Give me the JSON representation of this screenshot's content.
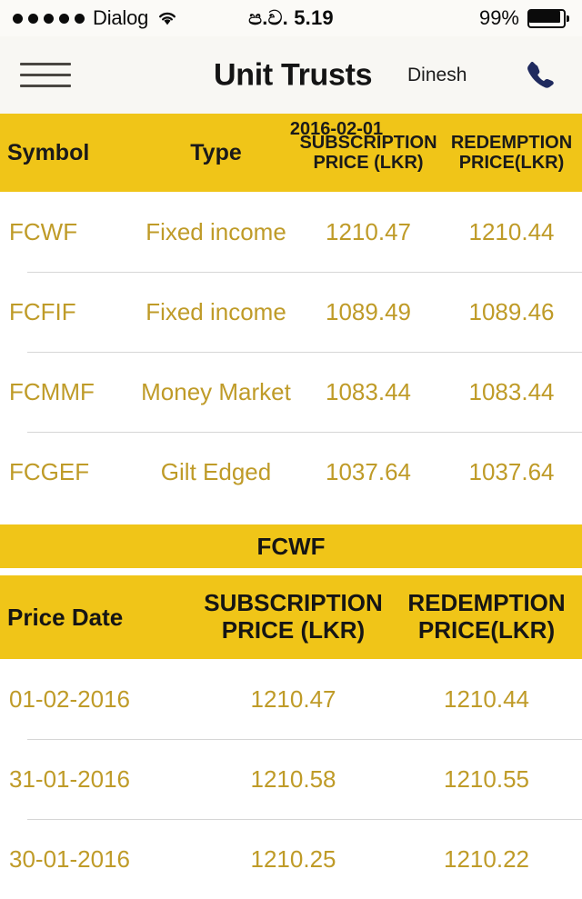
{
  "status_bar": {
    "signal_dots": 5,
    "carrier": "Dialog",
    "wifi_icon": "wifi-icon",
    "time": "ප.ව. 5.19",
    "battery_percent": "99%",
    "battery_level": 99
  },
  "nav_bar": {
    "menu_icon": "hamburger-menu-icon",
    "title": "Unit Trusts",
    "user": "Dinesh",
    "phone_icon": "phone-call-icon"
  },
  "funds_table": {
    "date": "2016-02-01",
    "columns": [
      "Symbol",
      "Type",
      "SUBSCRIPTION PRICE (LKR)",
      "REDEMPTION PRICE(LKR)"
    ],
    "column_labels": {
      "symbol": "Symbol",
      "type": "Type",
      "subscription_line1": "SUBSCRIPTION",
      "subscription_line2": "PRICE (LKR)",
      "redemption_line1": "REDEMPTION",
      "redemption_line2": "PRICE(LKR)"
    },
    "rows": [
      {
        "symbol": "FCWF",
        "type": "Fixed income",
        "subscription": "1210.47",
        "redemption": "1210.44"
      },
      {
        "symbol": "FCFIF",
        "type": "Fixed income",
        "subscription": "1089.49",
        "redemption": "1089.46"
      },
      {
        "symbol": "FCMMF",
        "type": "Money Market",
        "subscription": "1083.44",
        "redemption": "1083.44"
      },
      {
        "symbol": "FCGEF",
        "type": "Gilt Edged",
        "subscription": "1037.64",
        "redemption": "1037.64"
      }
    ]
  },
  "detail_table": {
    "fund_label": "FCWF",
    "column_labels": {
      "price_date": "Price Date",
      "subscription_line1": "SUBSCRIPTION",
      "subscription_line2": "PRICE (LKR)",
      "redemption_line1": "REDEMPTION",
      "redemption_line2": "PRICE(LKR)"
    },
    "rows": [
      {
        "date": "01-02-2016",
        "subscription": "1210.47",
        "redemption": "1210.44"
      },
      {
        "date": "31-01-2016",
        "subscription": "1210.58",
        "redemption": "1210.55"
      },
      {
        "date": "30-01-2016",
        "subscription": "1210.25",
        "redemption": "1210.22"
      }
    ]
  },
  "colors": {
    "header_yellow": "#f0c518",
    "value_gold": "#bf9b28",
    "nav_background": "#f8f7f3",
    "phone_icon": "#1f2a5e",
    "text_dark": "#151515"
  }
}
